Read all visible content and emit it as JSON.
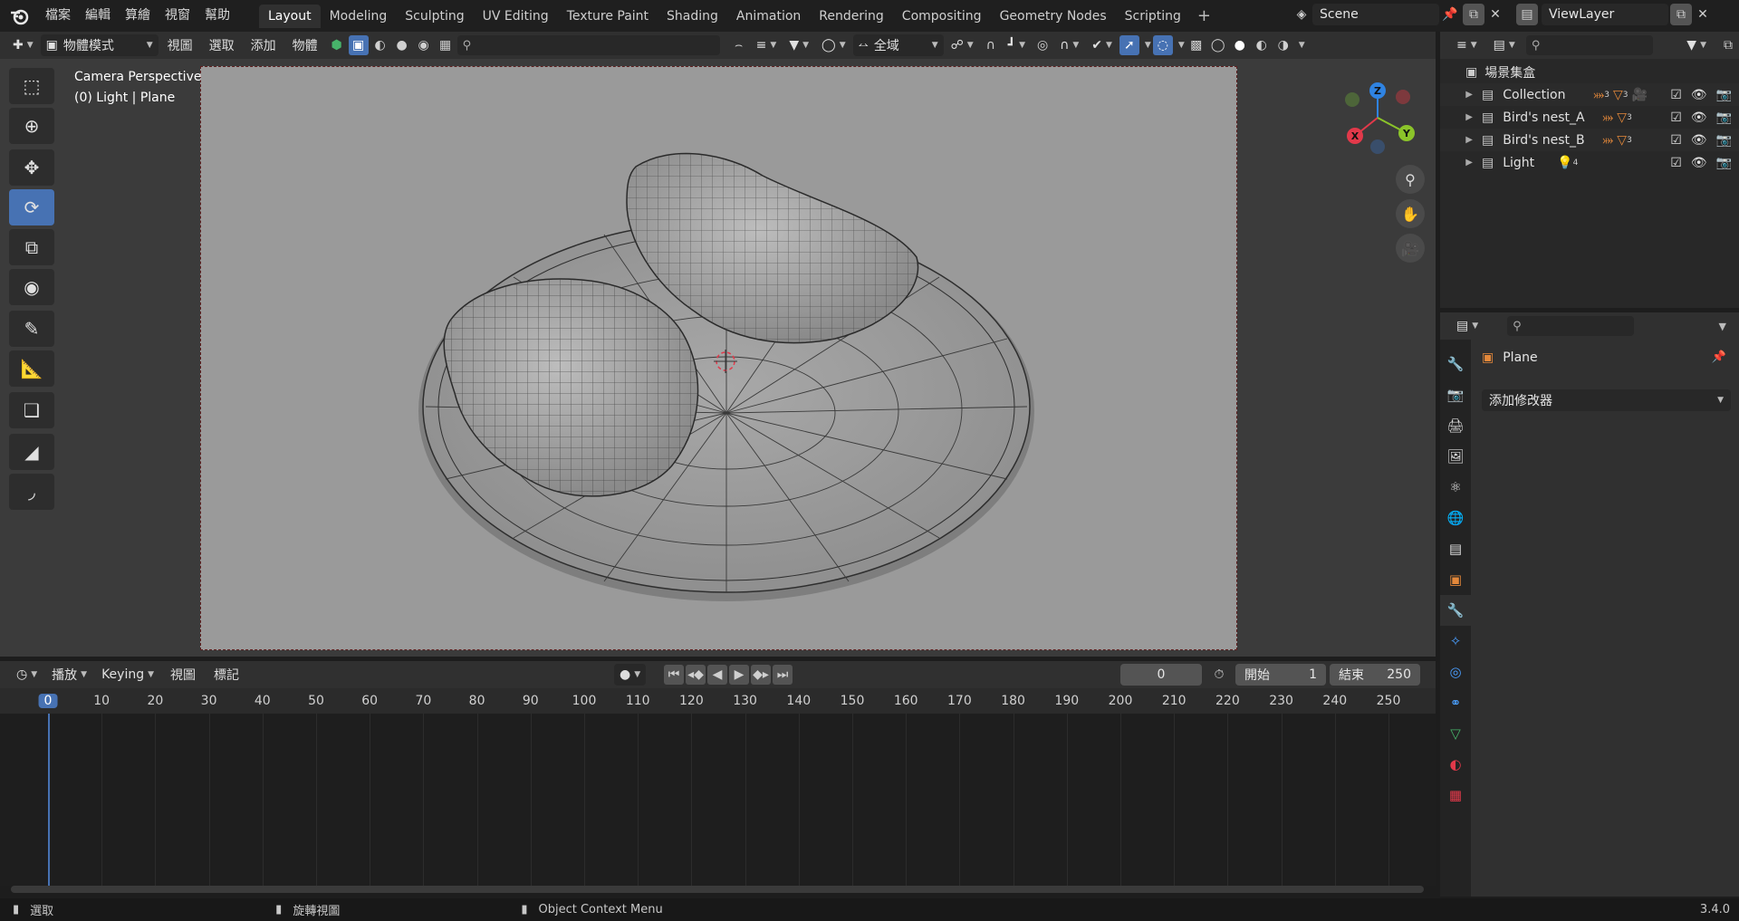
{
  "menus": [
    "檔案",
    "編輯",
    "算繪",
    "視窗",
    "幫助"
  ],
  "workspaces": [
    "Layout",
    "Modeling",
    "Sculpting",
    "UV Editing",
    "Texture Paint",
    "Shading",
    "Animation",
    "Rendering",
    "Compositing",
    "Geometry Nodes",
    "Scripting"
  ],
  "active_workspace": "Layout",
  "scene": "Scene",
  "view_layer": "ViewLayer",
  "viewport": {
    "mode": "物體模式",
    "menus": [
      "視圖",
      "選取",
      "添加",
      "物體"
    ],
    "transform_orientation": "全域",
    "info_line1": "Camera Perspective",
    "info_line2": "(0) Light | Plane",
    "gizmo": {
      "x": "X",
      "y": "Y",
      "z": "Z"
    }
  },
  "timeline": {
    "mode_menus": [
      "播放",
      "Keying",
      "視圖",
      "標記"
    ],
    "current_frame": "0",
    "start_label": "開始",
    "start_value": "1",
    "end_label": "結束",
    "end_value": "250",
    "ruler": [
      "0",
      "10",
      "20",
      "30",
      "40",
      "50",
      "60",
      "70",
      "80",
      "90",
      "100",
      "110",
      "120",
      "130",
      "140",
      "150",
      "160",
      "170",
      "180",
      "190",
      "200",
      "210",
      "220",
      "230",
      "240",
      "250"
    ]
  },
  "outliner": {
    "root": "場景集盒",
    "items": [
      {
        "name": "Collection",
        "badge1": "3",
        "badge2": "3"
      },
      {
        "name": "Bird's nest_A",
        "badge1": "3"
      },
      {
        "name": "Bird's nest_B",
        "badge1": "3"
      },
      {
        "name": "Light",
        "badge1": "4"
      }
    ]
  },
  "properties": {
    "object_name": "Plane",
    "add_modifier": "添加修改器"
  },
  "statusbar": {
    "select": "選取",
    "rotate": "旋轉視圖",
    "context": "Object Context Menu",
    "version": "3.4.0"
  },
  "colors": {
    "accent": "#4772b3",
    "axis_x": "#e2394a",
    "axis_y": "#8bc42a",
    "axis_z": "#2f83e2",
    "orange": "#e4883a"
  }
}
